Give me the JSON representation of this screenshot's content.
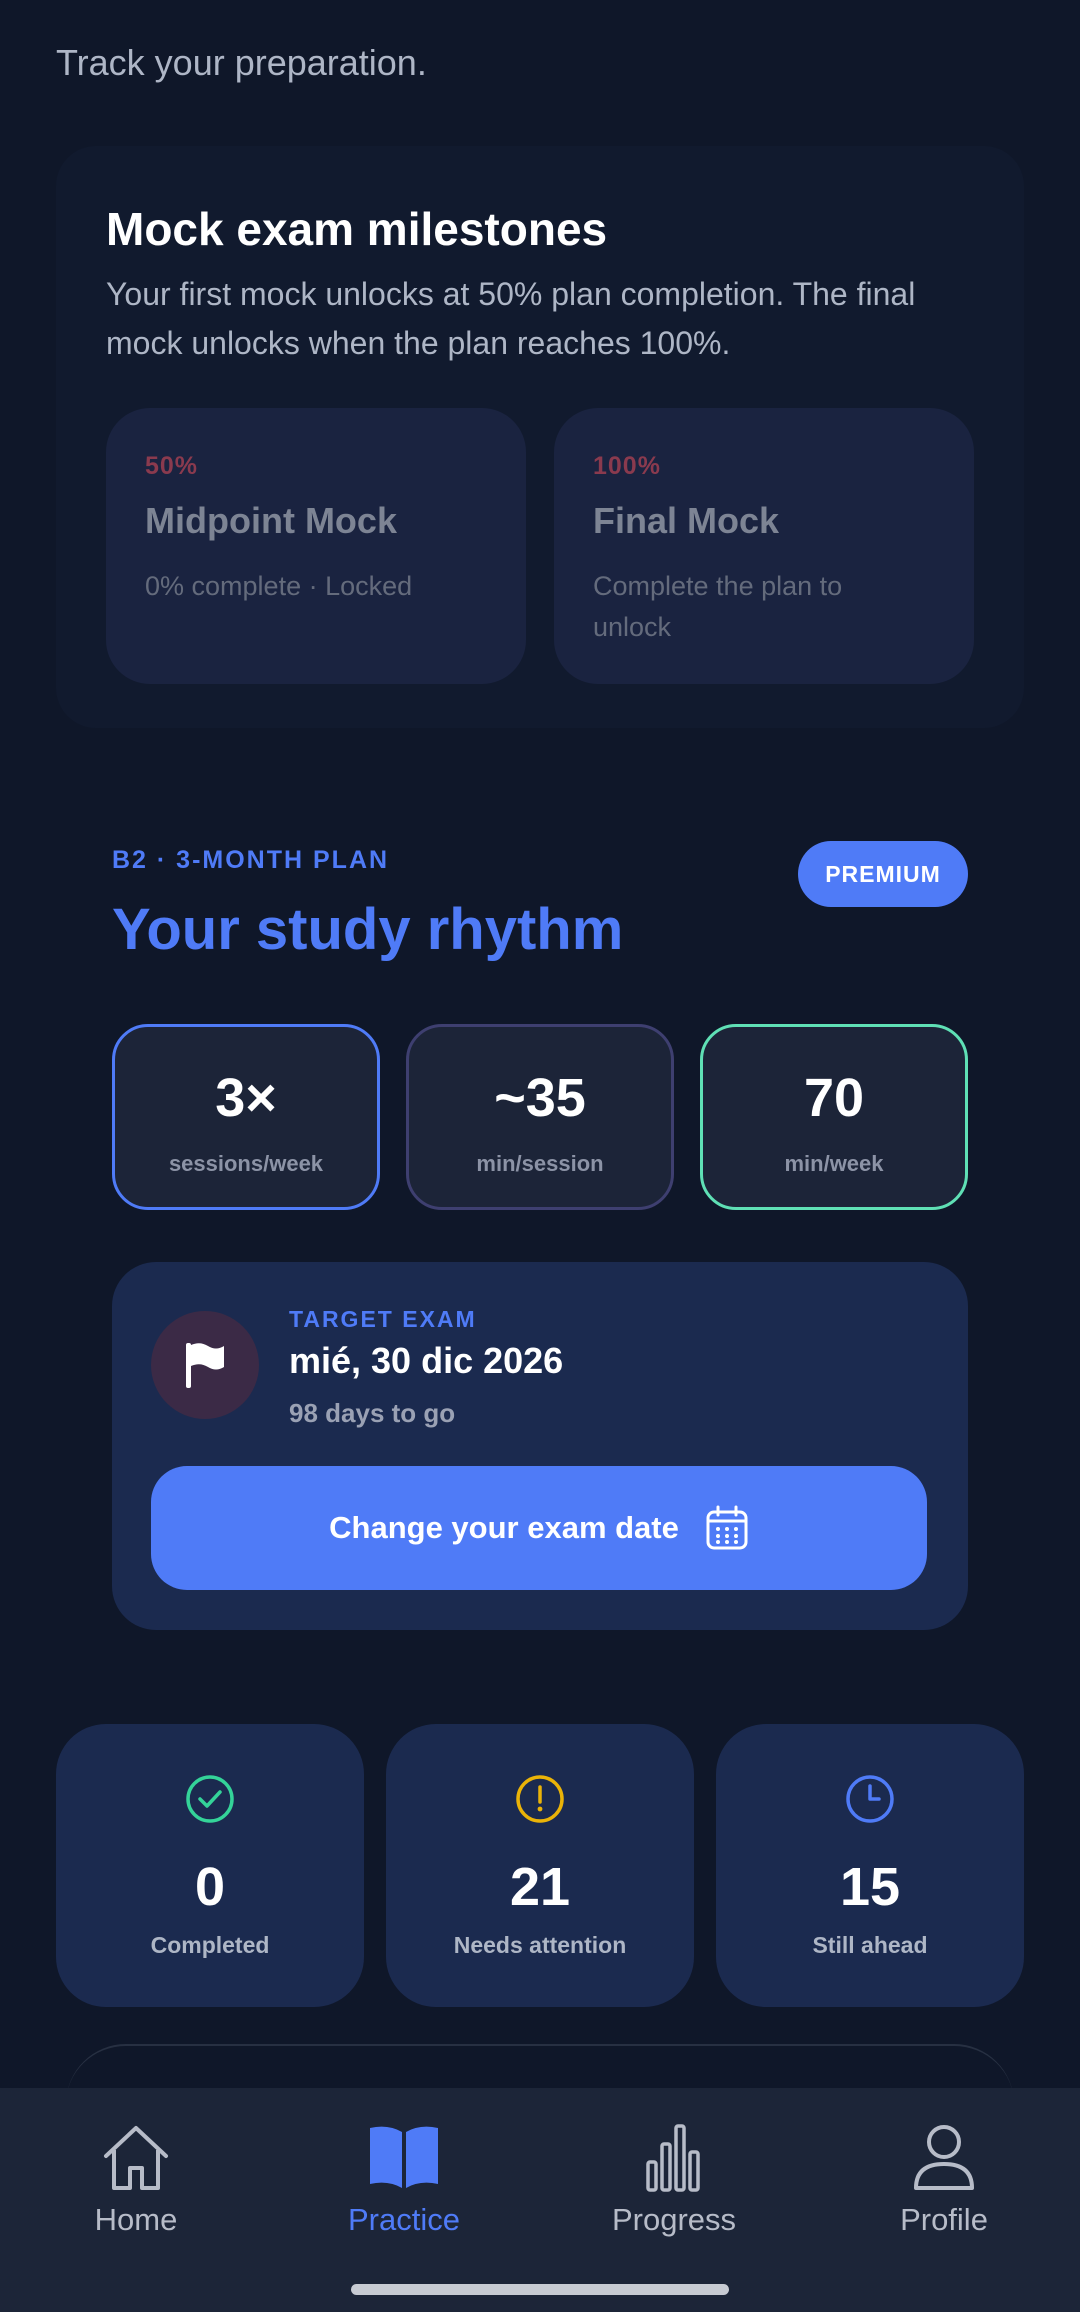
{
  "header": {
    "text": "Track your preparation."
  },
  "milestones": {
    "title": "Mock exam milestones",
    "description": "Your first mock unlocks at 50% plan completion. The final mock unlocks when the plan reaches 100%.",
    "mocks": [
      {
        "percent": "50%",
        "name": "Midpoint Mock",
        "status": "0% complete · Locked"
      },
      {
        "percent": "100%",
        "name": "Final Mock",
        "status": "Complete the plan to unlock"
      }
    ]
  },
  "rhythm": {
    "plan_label": "B2 · 3-MONTH PLAN",
    "premium_badge": "PREMIUM",
    "title": "Your study rhythm",
    "stats": [
      {
        "value": "3×",
        "label": "sessions/week"
      },
      {
        "value": "~35",
        "label": "min/session"
      },
      {
        "value": "70",
        "label": "min/week"
      }
    ]
  },
  "target_exam": {
    "label": "TARGET EXAM",
    "date": "mié, 30 dic 2026",
    "days_to_go": "98 days to go",
    "change_button": "Change your exam date"
  },
  "summary": [
    {
      "icon": "check-circle-icon",
      "value": "0",
      "label": "Completed",
      "color": "#34d399"
    },
    {
      "icon": "exclamation-circle-icon",
      "value": "21",
      "label": "Needs attention",
      "color": "#eab308"
    },
    {
      "icon": "clock-icon",
      "value": "15",
      "label": "Still ahead",
      "color": "#4f7bf7"
    }
  ],
  "nav": {
    "items": [
      {
        "label": "Home",
        "icon": "home-icon",
        "active": false
      },
      {
        "label": "Practice",
        "icon": "book-icon",
        "active": true
      },
      {
        "label": "Progress",
        "icon": "bar-chart-icon",
        "active": false
      },
      {
        "label": "Profile",
        "icon": "user-icon",
        "active": false
      }
    ]
  },
  "colors": {
    "background": "#0f1729",
    "accent": "#4f7bf7",
    "card": "#1b2a4f",
    "success": "#34d399",
    "warning": "#eab308",
    "locked_percent": "#8a3a4e"
  }
}
